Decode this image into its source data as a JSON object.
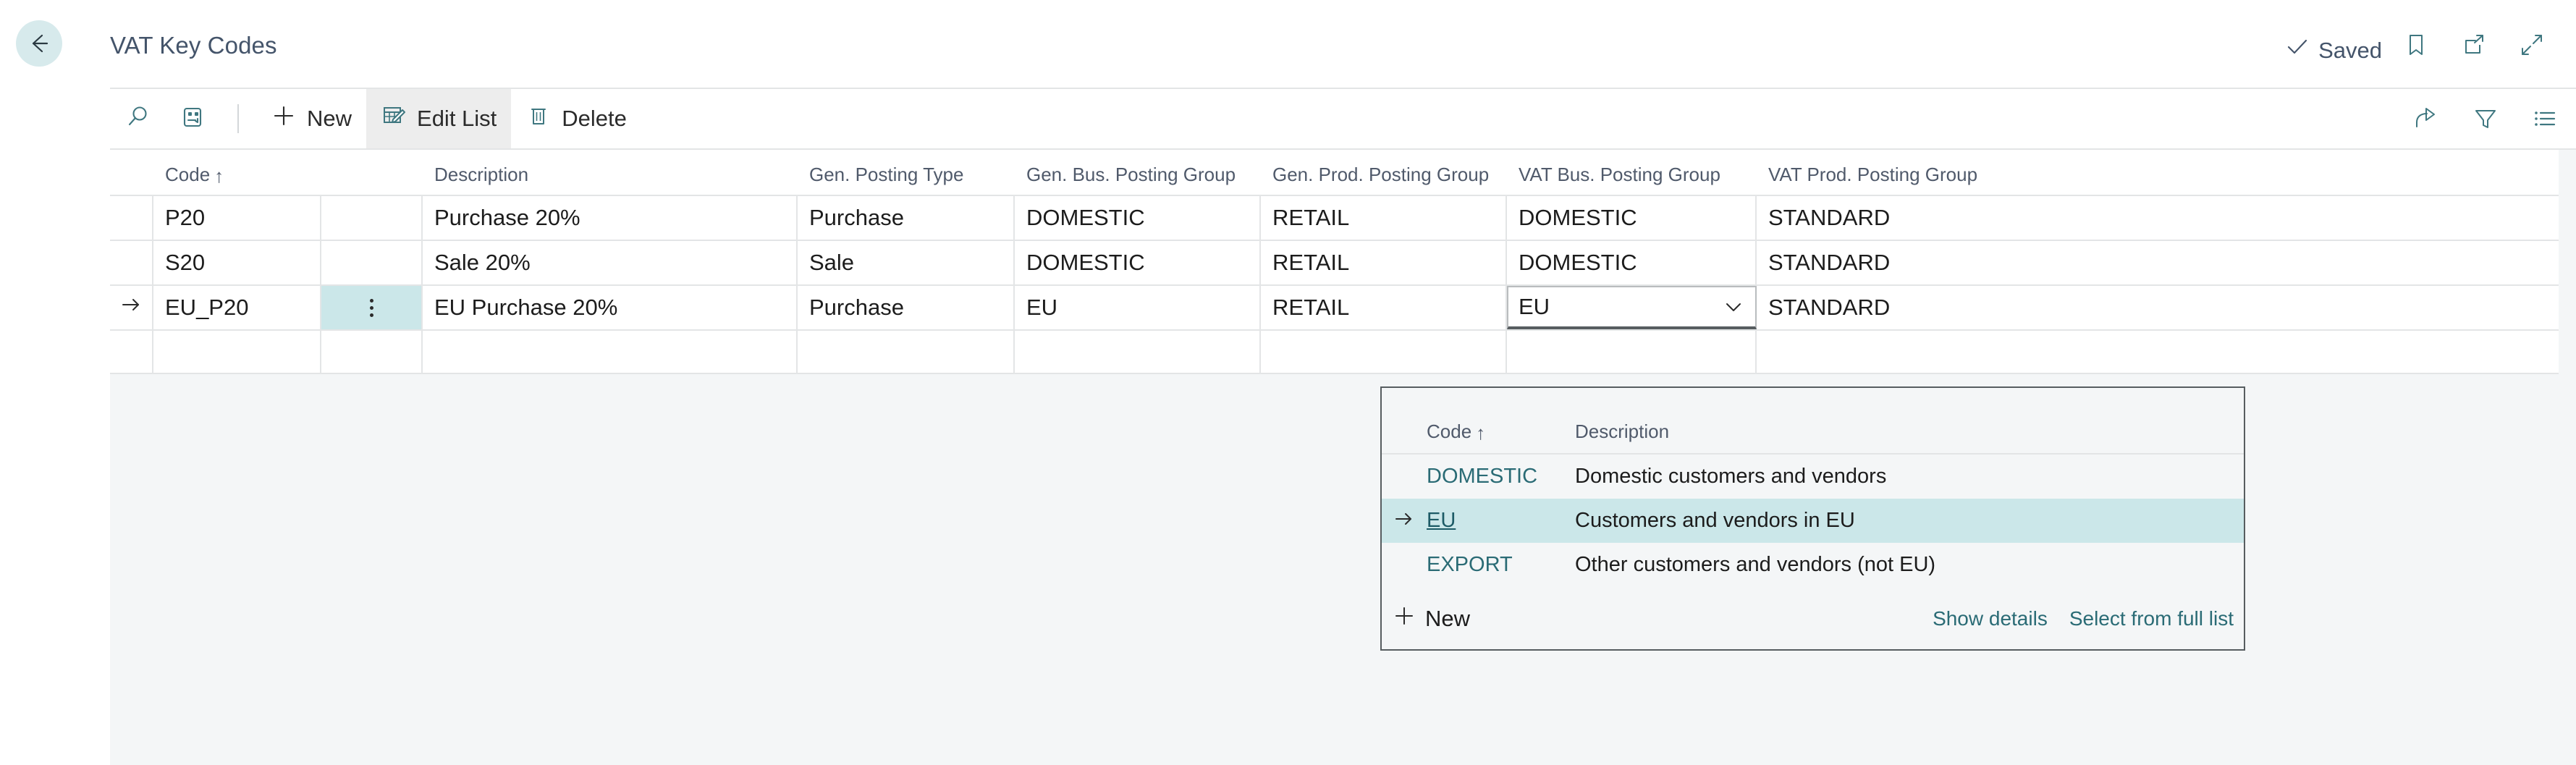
{
  "header": {
    "title": "VAT Key Codes",
    "back_icon": "back-arrow-icon",
    "status_label": "Saved",
    "status_icon": "checkmark-icon",
    "icons": [
      {
        "name": "bookmark-icon"
      },
      {
        "name": "open-in-new-window-icon"
      },
      {
        "name": "collapse-icon"
      }
    ]
  },
  "toolbar": {
    "search_icon": "search-icon",
    "card_refresh_icon": "open-in-card-icon",
    "new_label": "New",
    "new_icon": "plus-icon",
    "edit_list_label": "Edit List",
    "edit_list_icon": "edit-list-icon",
    "delete_label": "Delete",
    "delete_icon": "trash-icon",
    "right_icons": [
      {
        "name": "share-icon"
      },
      {
        "name": "filter-icon"
      },
      {
        "name": "list-view-icon"
      }
    ]
  },
  "grid": {
    "columns": [
      {
        "key": "code",
        "label": "Code",
        "sorted": "↑"
      },
      {
        "key": "description",
        "label": "Description",
        "sorted": ""
      },
      {
        "key": "gen_posting_type",
        "label": "Gen. Posting Type",
        "sorted": ""
      },
      {
        "key": "gen_bus_posting_group",
        "label": "Gen. Bus. Posting Group",
        "sorted": ""
      },
      {
        "key": "gen_prod_posting_group",
        "label": "Gen. Prod. Posting Group",
        "sorted": ""
      },
      {
        "key": "vat_bus_posting_group",
        "label": "VAT Bus. Posting Group",
        "sorted": ""
      },
      {
        "key": "vat_prod_posting_group",
        "label": "VAT Prod. Posting Group",
        "sorted": ""
      }
    ],
    "rows": [
      {
        "selected": false,
        "code": "P20",
        "description": "Purchase 20%",
        "gen_posting_type": "Purchase",
        "gen_bus_posting_group": "DOMESTIC",
        "gen_prod_posting_group": "RETAIL",
        "vat_bus_posting_group": "DOMESTIC",
        "vat_prod_posting_group": "STANDARD"
      },
      {
        "selected": false,
        "code": "S20",
        "description": "Sale 20%",
        "gen_posting_type": "Sale",
        "gen_bus_posting_group": "DOMESTIC",
        "gen_prod_posting_group": "RETAIL",
        "vat_bus_posting_group": "DOMESTIC",
        "vat_prod_posting_group": "STANDARD"
      },
      {
        "selected": true,
        "row_indicator": "→",
        "code": "EU_P20",
        "description": "EU Purchase 20%",
        "gen_posting_type": "Purchase",
        "gen_bus_posting_group": "EU",
        "gen_prod_posting_group": "RETAIL",
        "vat_bus_posting_group": "EU",
        "vat_prod_posting_group": "STANDARD"
      },
      {
        "selected": false,
        "code": "",
        "description": "",
        "gen_posting_type": "",
        "gen_bus_posting_group": "",
        "gen_prod_posting_group": "",
        "vat_bus_posting_group": "",
        "vat_prod_posting_group": ""
      }
    ]
  },
  "dropdown": {
    "open": true,
    "field": "VAT Bus. Posting Group",
    "value": "EU",
    "chevron_icon": "chevron-down-icon",
    "columns": [
      {
        "label": "Code",
        "sorted": "↑"
      },
      {
        "label": "Description",
        "sorted": ""
      }
    ],
    "options": [
      {
        "code": "DOMESTIC",
        "description": "Domestic customers and vendors",
        "selected": false
      },
      {
        "code": "EU",
        "description": "Customers and vendors in EU",
        "selected": true,
        "indicator": "→"
      },
      {
        "code": "EXPORT",
        "description": "Other customers and vendors (not EU)",
        "selected": false
      }
    ],
    "footer": {
      "new_label": "New",
      "new_icon": "plus-icon",
      "show_details_label": "Show details",
      "select_full_list_label": "Select from full list"
    }
  },
  "colors": {
    "accent_teal": "#2a6b75",
    "selection_teal": "#cbe7e9",
    "back_button_bg": "#d7eaec",
    "header_text": "#44546a",
    "page_bg": "#f4f6f7",
    "grid_line": "#e3e5e6"
  }
}
